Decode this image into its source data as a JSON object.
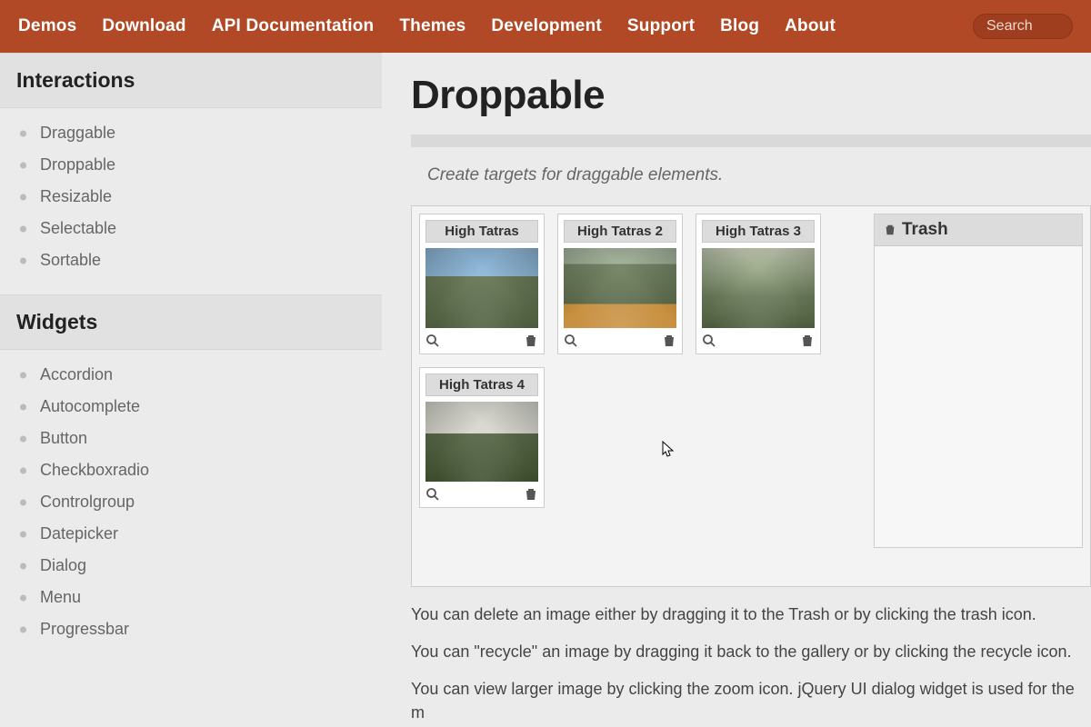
{
  "nav": {
    "items": [
      "Demos",
      "Download",
      "API Documentation",
      "Themes",
      "Development",
      "Support",
      "Blog",
      "About"
    ],
    "search_placeholder": "Search"
  },
  "sidebar": {
    "sections": [
      {
        "title": "Interactions",
        "items": [
          "Draggable",
          "Droppable",
          "Resizable",
          "Selectable",
          "Sortable"
        ]
      },
      {
        "title": "Widgets",
        "items": [
          "Accordion",
          "Autocomplete",
          "Button",
          "Checkboxradio",
          "Controlgroup",
          "Datepicker",
          "Dialog",
          "Menu",
          "Progressbar"
        ]
      }
    ]
  },
  "page": {
    "title": "Droppable",
    "subtitle": "Create targets for draggable elements."
  },
  "gallery": {
    "cards": [
      {
        "title": "High Tatras"
      },
      {
        "title": "High Tatras 2"
      },
      {
        "title": "High Tatras 3"
      },
      {
        "title": "High Tatras 4"
      }
    ]
  },
  "trash": {
    "label": "Trash"
  },
  "description": {
    "p1": "You can delete an image either by dragging it to the Trash or by clicking the trash icon.",
    "p2": "You can \"recycle\" an image by dragging it back to the gallery or by clicking the recycle icon.",
    "p3": "You can view larger image by clicking the zoom icon. jQuery UI dialog widget is used for the m"
  }
}
